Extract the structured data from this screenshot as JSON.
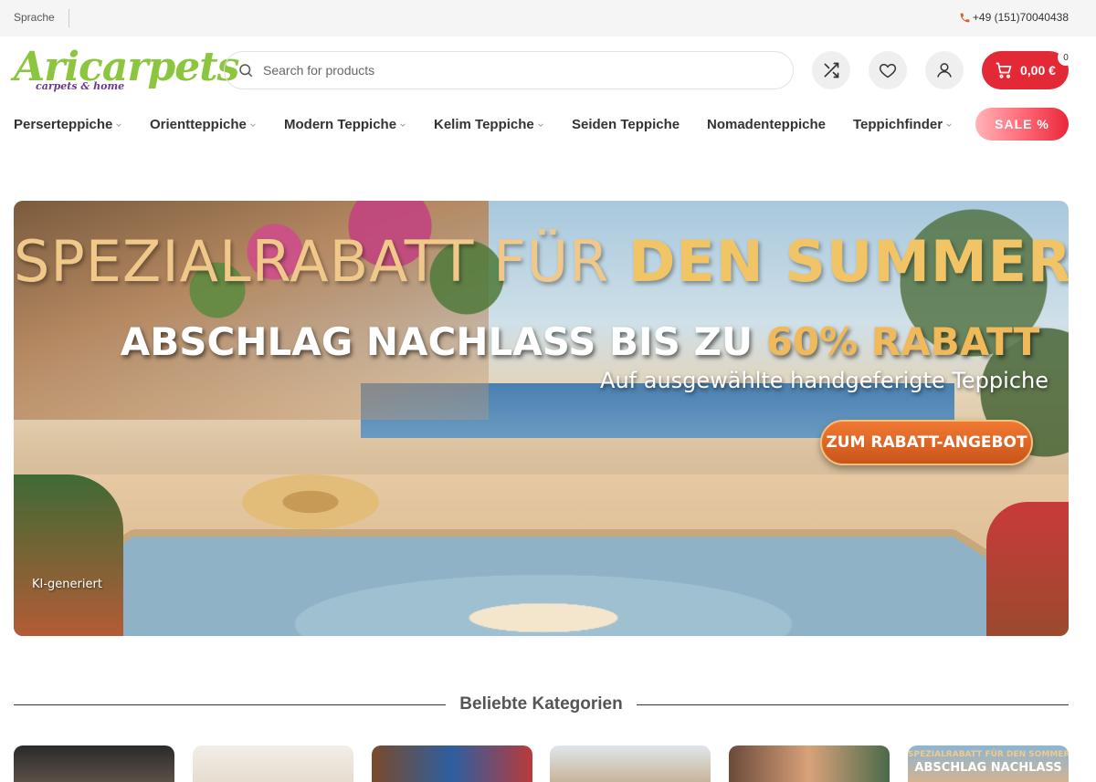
{
  "topbar": {
    "language": "Sprache",
    "phone": "+49 (151)70040438"
  },
  "header": {
    "logo_text": "Aricarpets",
    "logo_tagline": "carpets & home",
    "search_placeholder": "Search for products",
    "cart_amount": "0,00 €",
    "cart_count": "0"
  },
  "nav": {
    "items": [
      {
        "label": "Perserteppiche",
        "has_dropdown": true
      },
      {
        "label": "Orientteppiche",
        "has_dropdown": true
      },
      {
        "label": "Modern Teppiche",
        "has_dropdown": true
      },
      {
        "label": "Kelim Teppiche",
        "has_dropdown": true
      },
      {
        "label": "Seiden Teppiche",
        "has_dropdown": false
      },
      {
        "label": "Nomadenteppiche",
        "has_dropdown": false
      },
      {
        "label": "Teppichfinder",
        "has_dropdown": true
      }
    ],
    "sale": "SALE %"
  },
  "hero": {
    "headline_part1": "SPEZIALRABATT FÜR",
    "headline_part2": "DEN SUMMER",
    "subheadline_part1": "ABSCHLAG NACHLASS BIS ZU",
    "subheadline_part2": "60% RABATT",
    "tagline": "Auf ausgewählte handgeferigte Teppiche",
    "cta": "ZUM RABATT-ANGEBOT",
    "note": "KI-generiert"
  },
  "categories": {
    "title": "Beliebte Kategorien",
    "thumb_banner_line1": "SPEZIALRABATT FÜR DEN SOMMER",
    "thumb_banner_line2": "ABSCHLAG NACHLASS"
  },
  "colors": {
    "brand_green": "#8cc63f",
    "brand_purple": "#6b3b8a",
    "cart_red": "#e32836"
  }
}
